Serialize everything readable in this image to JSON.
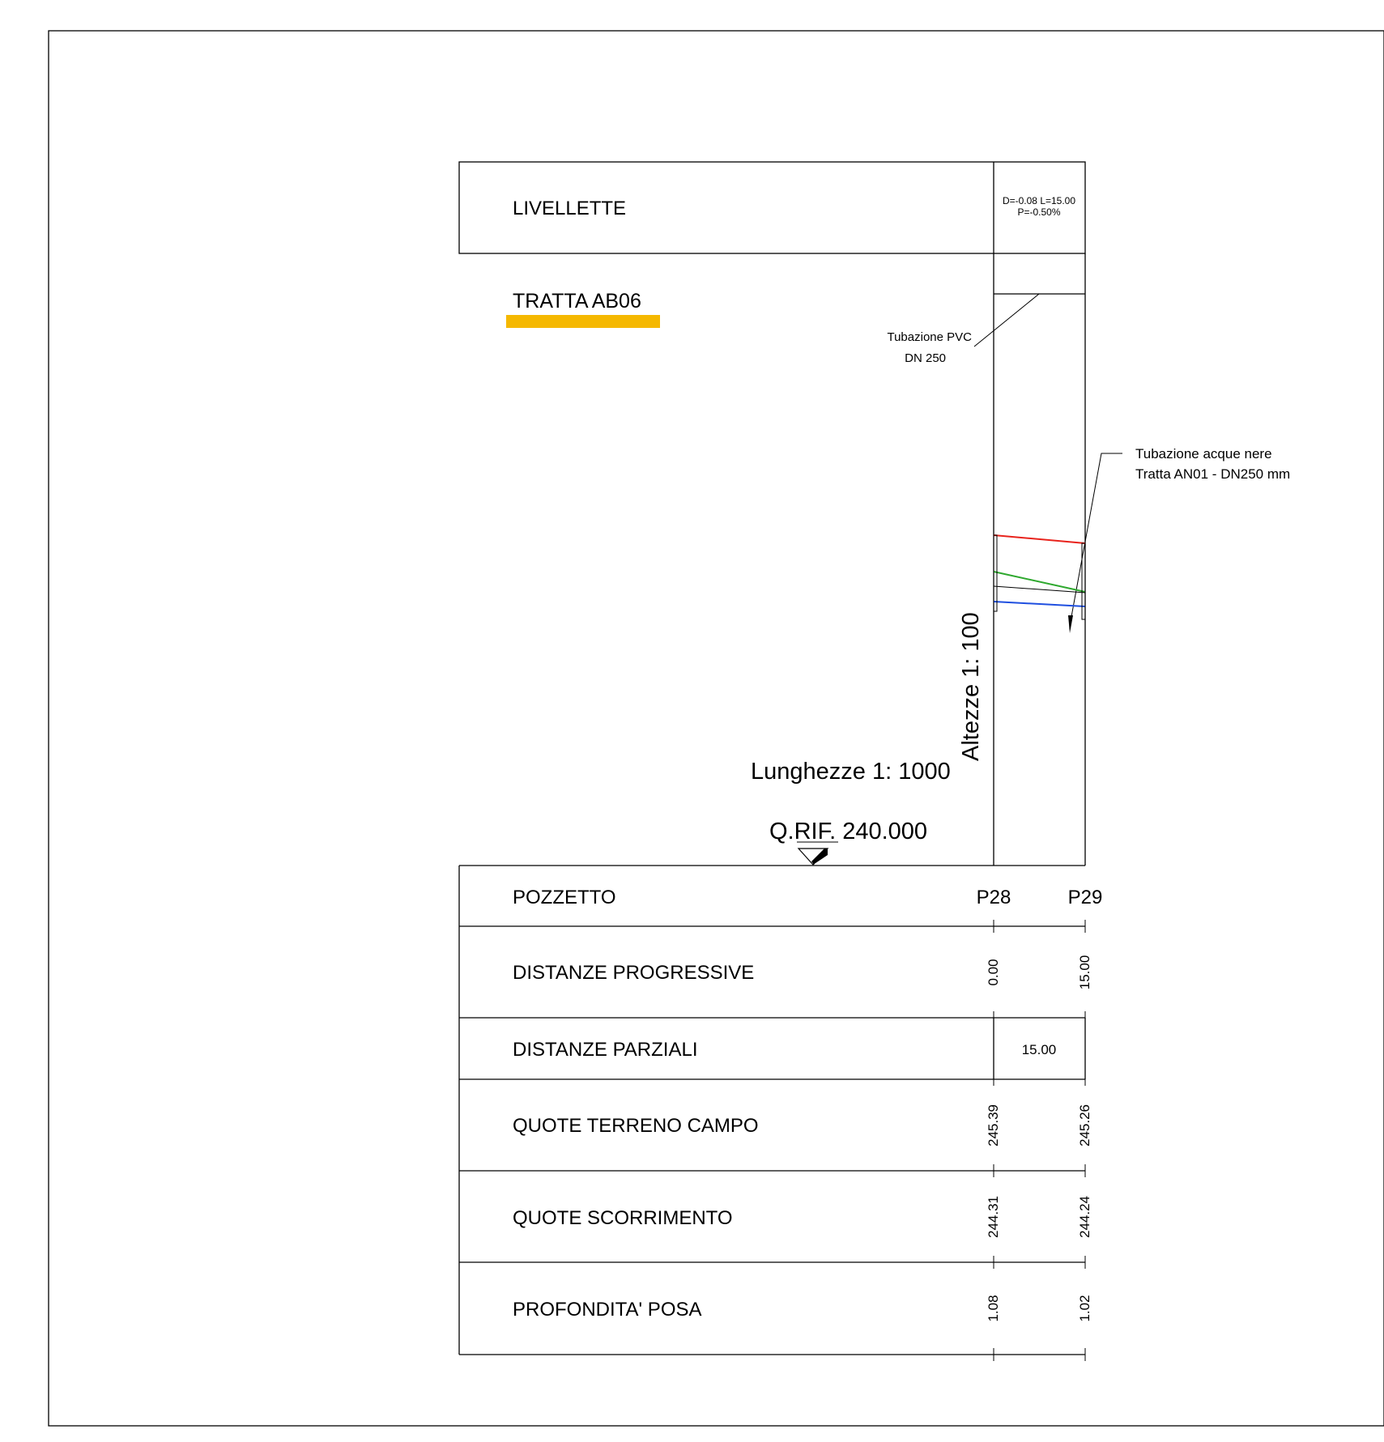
{
  "header": {
    "livellette_label": "LIVELLETTE",
    "livellette_value_line1": "D=-0.08 L=15.00",
    "livellette_value_line2": "P=-0.50%",
    "tratta_title": "TRATTA AB06"
  },
  "annotations": {
    "pipe_pvc_line1": "Tubazione PVC",
    "pipe_pvc_line2": "DN 250",
    "pipe_acque_line1": "Tubazione acque nere",
    "pipe_acque_line2": "Tratta AN01 - DN250 mm"
  },
  "scales": {
    "heights": "Altezze 1: 100",
    "lengths": "Lunghezze 1: 1000",
    "reference": "Q.RIF. 240.000"
  },
  "table": {
    "rows": [
      {
        "label": "POZZETTO",
        "values": [
          "P28",
          "P29"
        ]
      },
      {
        "label": "DISTANZE PROGRESSIVE",
        "values": [
          "0.00",
          "15.00"
        ]
      },
      {
        "label": "DISTANZE PARZIALI",
        "values": [
          "15.00"
        ]
      },
      {
        "label": "QUOTE TERRENO CAMPO",
        "values": [
          "245.39",
          "245.26"
        ]
      },
      {
        "label": "QUOTE SCORRIMENTO",
        "values": [
          "244.31",
          "244.24"
        ]
      },
      {
        "label": "PROFONDITA' POSA",
        "values": [
          "1.08",
          "1.02"
        ]
      }
    ]
  },
  "colors": {
    "tratta_highlight": "#F5B800",
    "terrain_line": "#E8231C",
    "green_line": "#2EA82E",
    "blue_line": "#1F4FE0"
  }
}
